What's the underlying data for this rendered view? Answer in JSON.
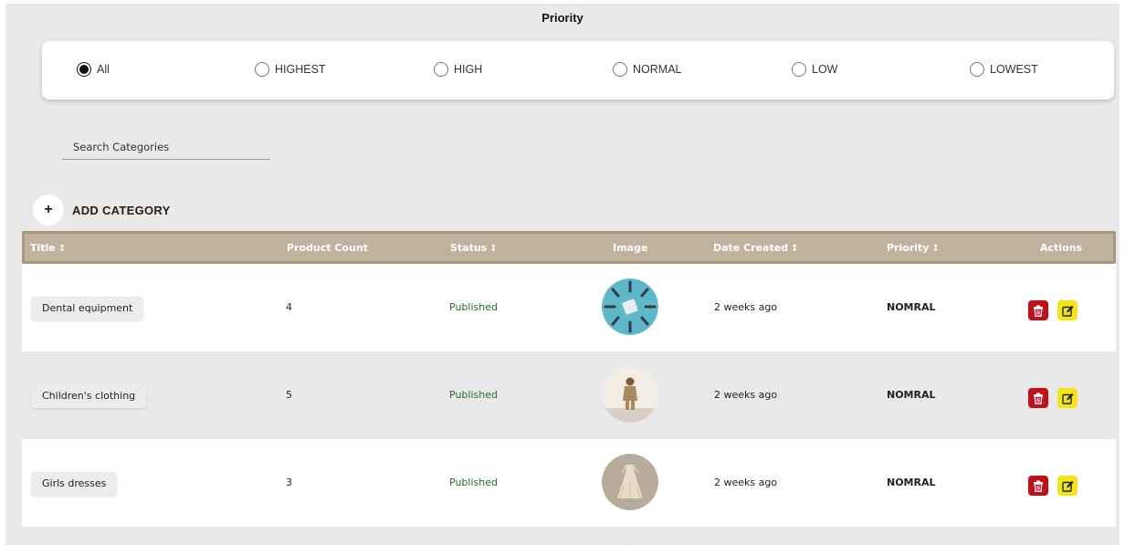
{
  "priority": {
    "title": "Priority",
    "options": [
      "All",
      "HIGHEST",
      "HIGH",
      "NORMAL",
      "LOW",
      "LOWEST"
    ],
    "selected": "All"
  },
  "search": {
    "placeholder": "Search Categories"
  },
  "add_button": {
    "icon": "+",
    "label": "ADD CATEGORY"
  },
  "table": {
    "headers": {
      "title": "Title",
      "product_count": "Product Count",
      "status": "Status",
      "image": "Image",
      "date_created": "Date Created",
      "priority": "Priority",
      "actions": "Actions"
    },
    "sort_glyph": "↕",
    "rows": [
      {
        "title": "Dental equipment",
        "product_count": "4",
        "status": "Published",
        "image_icon": "dental-tools-image",
        "date_created": "2 weeks ago",
        "priority": "NOMRAL"
      },
      {
        "title": "Children's clothing",
        "product_count": "5",
        "status": "Published",
        "image_icon": "child-outfit-image",
        "date_created": "2 weeks ago",
        "priority": "NOMRAL"
      },
      {
        "title": "Girls dresses",
        "product_count": "3",
        "status": "Published",
        "image_icon": "girl-dress-image",
        "date_created": "2 weeks ago",
        "priority": "NOMRAL"
      }
    ],
    "action_icons": {
      "delete": "trash-icon",
      "edit": "edit-icon"
    }
  },
  "colors": {
    "header_bg": "#bfb39d",
    "delete": "#c0101a",
    "edit": "#f4e51a",
    "status": "#2e6b2f"
  }
}
